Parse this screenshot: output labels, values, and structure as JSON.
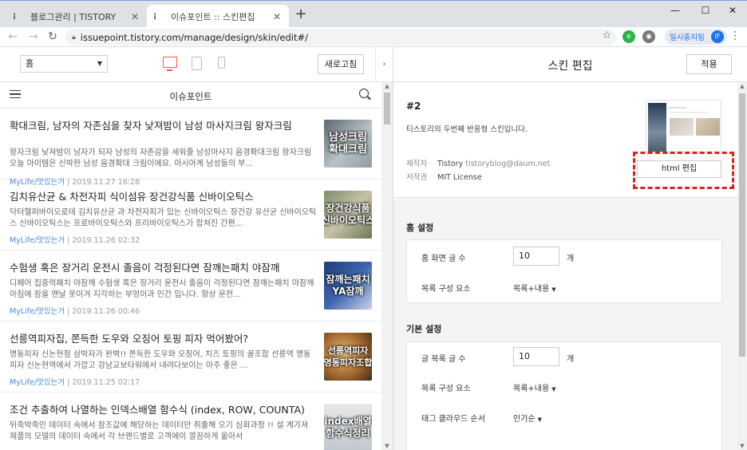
{
  "browser": {
    "tabs": [
      {
        "title": "블로그관리 | TISTORY",
        "active": false
      },
      {
        "title": "이슈포인트 :: 스킨편집",
        "active": true
      }
    ],
    "url": "issuepoint.tistory.com/manage/design/skin/edit#/",
    "profile_label": "일시중지됨",
    "profile_initial": "IF"
  },
  "preview": {
    "page_select": "홈",
    "refresh_label": "새로고침",
    "blog_title": "이슈포인트",
    "posts": [
      {
        "title": "확대크림, 남자의 자존심을 찾자 낮져밤이 남성 마사지크림 왕자크림",
        "excerpt": "왕자크림 낮져밤이 남자가 되자 남성의 자존감을 세워줄 남성마사지 음경확대크림 왕자크림 오늘 아이템은 신박한 남성 음경확대 크림이에요. 아시아계 남성들의 부...",
        "category": "MyLife/맛있는거",
        "date": "2019.11.27 16:28",
        "thumb_text": "남성크림\n확대크림"
      },
      {
        "title": "김치유산균 & 차전자피 식이섬유 장건강식품 신바이오틱스",
        "excerpt": "닥터헬퍼바이오로테 김치유산균 과 차전자피가 있는 신바이오틱스 장건강 유산균 신바이오틱스 신바이오틱스는 프로바이오틱스와 프리바이오틱스가 합쳐진 간편...",
        "category": "MyLife/맛있는거",
        "date": "2019.11.26 02:32",
        "thumb_text": "장건강식품\n신바이오틱스"
      },
      {
        "title": "수험생 혹은 장거리 운전시 졸음이 걱정된다면 잠깨는패치 야잠깨",
        "excerpt": "디페어 집중력패치 야잠깨 수험생 혹은 장거리 운전시 졸음이 걱정된다면 잠깨는패치 야잠깨 아침에 잠을 맨날 못이겨 지각하는 부엉이과 인간 입니다. 항상 운전...",
        "category": "MyLife/맛있는거",
        "date": "2019.11.26 00:46",
        "thumb_text": "잠깨는패치\nYA잠깨"
      },
      {
        "title": "선릉역피자집, 쫀득한 도우와 오징어 토핑 피자 먹어봤어?",
        "excerpt": "명동피자 신논현점 삼박자가 완벽!! 쫀득한 도우와 오징어, 치즈 토핑의 꿀조합 선릉역 명동피자 신논현역에서 가깝고 강남교보타워에서 내려다보이는 아주 좋은 ...",
        "category": "MyLife/맛있는거",
        "date": "2019.11.25 02:17",
        "thumb_text": "선릉역피자\n명동피자조합"
      },
      {
        "title": "조건 추출하여 나열하는 인덱스배열 함수식 (index, ROW, COUNTA)",
        "excerpt": "뒤죽박죽인 데이터 속에서 참조값에 해당하는 데이터만 취출해 오기 심화과정 !! 설 계가져 제품의 모델의 데이터 속에서 각 브랜드별로 고객에이 깔끔하게 옮아서",
        "category": "MyLife/맛있는거",
        "date": "2019.11.24 01:10",
        "thumb_text": "index배열\n함수식정리"
      }
    ]
  },
  "skin": {
    "header_title": "스킨 편집",
    "apply_label": "적용",
    "number": "#2",
    "description": "티스토리의 두번째 반응형 스킨입니다.",
    "maker_label": "제작자",
    "maker_name": "Tistory",
    "maker_email": "tistoryblog@daum.net",
    "license_label": "저작권",
    "license_value": "MIT License",
    "html_edit_label": "html 편집",
    "home_settings": {
      "title": "홈 설정",
      "post_count_label": "홈 화면 글 수",
      "post_count_value": "10",
      "unit": "개",
      "list_label": "목록 구성 요소",
      "list_value": "목록+내용"
    },
    "basic_settings": {
      "title": "기본 설정",
      "list_count_label": "글 목록 글 수",
      "list_count_value": "10",
      "unit": "개",
      "list_label": "목록 구성 요소",
      "list_value": "목록+내용",
      "tag_order_label": "태그 클라우드 순서",
      "tag_order_value": "인기순"
    }
  },
  "colors": {
    "accent_red": "#e02020",
    "category_link": "#4b8ad6"
  }
}
